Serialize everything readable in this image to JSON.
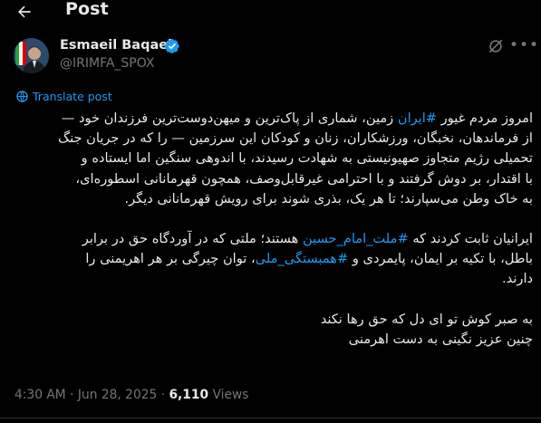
{
  "header": {
    "title": "Post"
  },
  "author": {
    "name": "Esmaeil Baqaei",
    "handle": "@IRIMFA_SPOX",
    "verified": true
  },
  "translate": {
    "label": "Translate post"
  },
  "post": {
    "lines": [
      [
        {
          "t": "امروز مردم غیور "
        },
        {
          "t": "#ایران",
          "tag": true
        },
        {
          "t": " زمین، شماری از پاک‌ترین و میهن‌دوست‌ترین فرزندان خود —"
        }
      ],
      [
        {
          "t": "از فرماندهان، نخبگان، ورزشکاران، زنان و کودکان این سرزمین — را که در جریان جنگ"
        }
      ],
      [
        {
          "t": "تحمیلی رژیم متجاوز صهیونیستی به شهادت رسیدند، با اندوهی سنگین اما ایستاده و"
        }
      ],
      [
        {
          "t": "با اقتدار، بر دوش گرفتند و با احترامی غیرقابل‌وصف، همچون قهرمانانی اسطوره‌ای،"
        }
      ],
      [
        {
          "t": "به خاک وطن می‌سپارند؛ تا هر یک، بذری شوند برای رویش قهرمانانی دیگر."
        }
      ],
      "gap",
      [
        {
          "t": "ایرانیان ثابت کردند که "
        },
        {
          "t": "#ملت_امام_حسین",
          "tag": true
        },
        {
          "t": " هستند؛ ملتی که در آوردگاه حق در برابر"
        }
      ],
      [
        {
          "t": "باطل، با تکیه بر ایمان، پایمردی و "
        },
        {
          "t": "#همبستگی_ملی",
          "tag": true
        },
        {
          "t": "، توان چیرگی بر هر اهریمنی را"
        }
      ],
      [
        {
          "t": "دارند."
        }
      ],
      "gap",
      [
        {
          "t": "به صبر کوش تو ای دل که حق رها نکند"
        }
      ],
      [
        {
          "t": "چنین عزیز نگینی به دست اهرمنی"
        }
      ]
    ]
  },
  "meta": {
    "time": "4:30 AM",
    "date": "Jun 28, 2025",
    "views_count": "6,110",
    "views_label": "Views"
  },
  "colors": {
    "background": "#000000",
    "text": "#e7e9ea",
    "secondary": "#71767b",
    "accent": "#1d9bf0"
  }
}
